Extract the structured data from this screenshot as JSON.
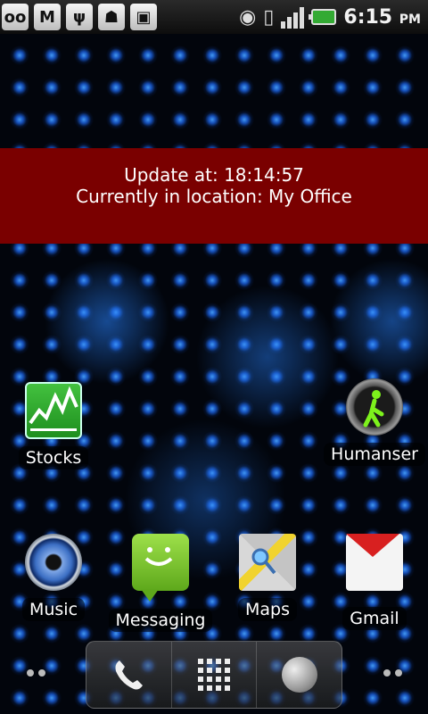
{
  "status_bar": {
    "notification_icons": [
      "voicemail-icon",
      "gmail-icon",
      "usb-icon",
      "android-debug-icon",
      "sync-icon"
    ],
    "system_icons": [
      "wifi-icon",
      "vibrate-icon",
      "signal-icon",
      "battery-icon"
    ],
    "time": "6:15",
    "ampm": "PM"
  },
  "widget": {
    "line1": "Update at: 18:14:57",
    "line2": "Currently in location: My Office"
  },
  "apps": {
    "stocks": "Stocks",
    "humanser": "Humanser",
    "music": "Music",
    "messaging": "Messaging",
    "maps": "Maps",
    "gmail": "Gmail"
  },
  "dock": {
    "items": [
      "phone-icon",
      "app-drawer-icon",
      "browser-icon"
    ]
  },
  "colors": {
    "widget_bg": "#7a0000",
    "accent_blue": "#2e8bff"
  }
}
